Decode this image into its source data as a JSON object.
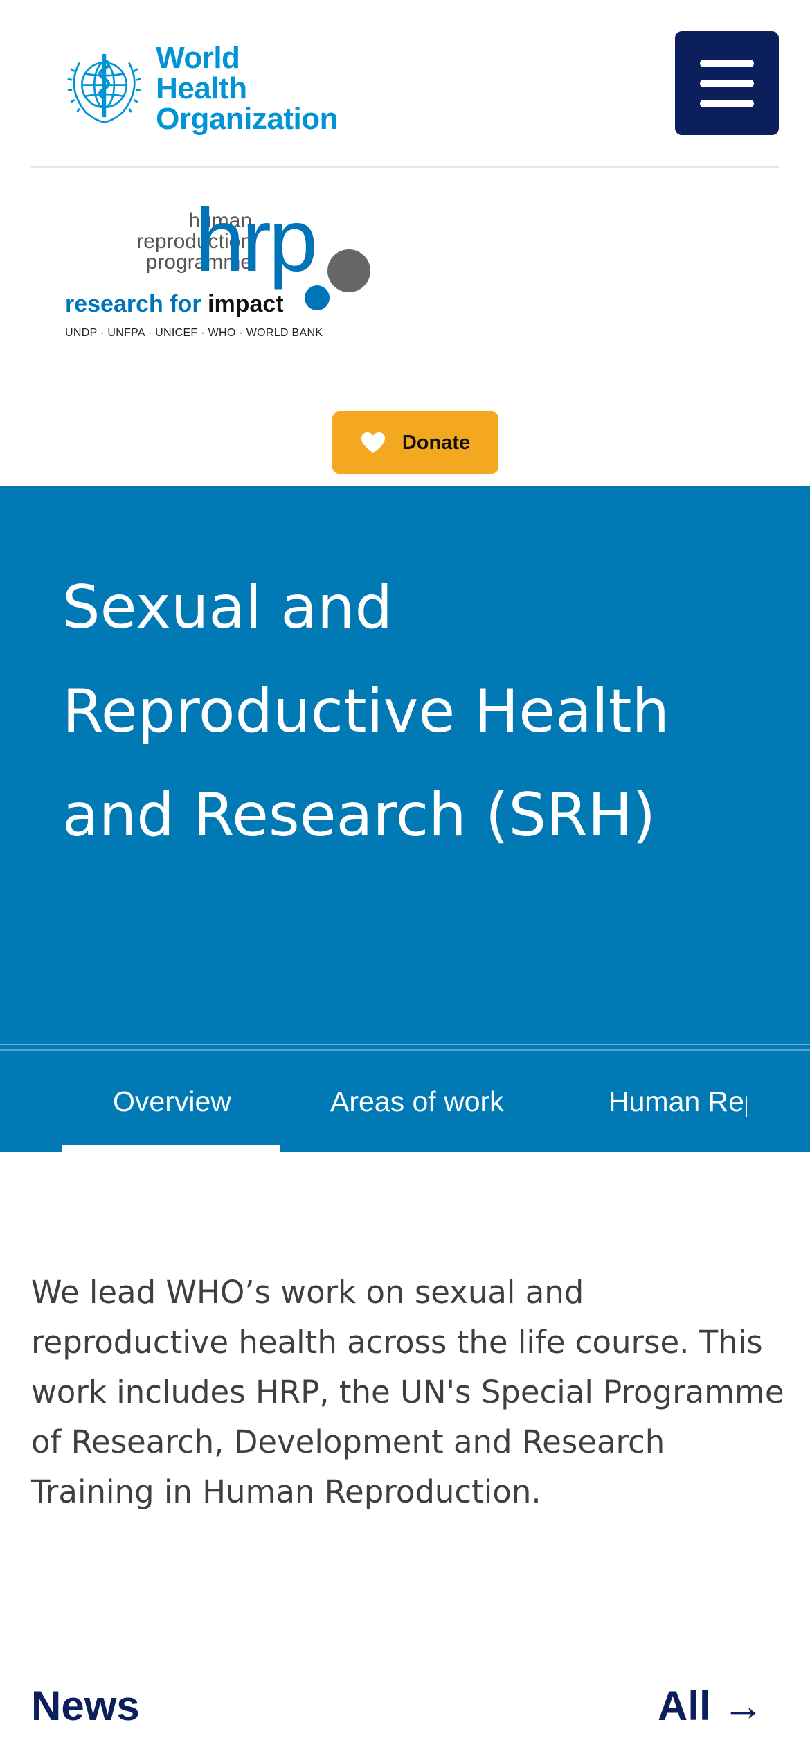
{
  "header": {
    "logo_line1": "World Health",
    "logo_line2": "Organization",
    "menu_icon": "hamburger-menu-icon"
  },
  "hrp_logo": {
    "left_words": [
      "human",
      "reproduction",
      "programme"
    ],
    "big_text": "hrp",
    "tagline_part1": "research for ",
    "tagline_part2": "impact",
    "partners": "UNDP · UNFPA · UNICEF · WHO · WORLD BANK"
  },
  "donate": {
    "label": "Donate",
    "icon": "heart-icon",
    "color": "#f3a81f"
  },
  "hero": {
    "title": "Sexual and Reproductive Health and Research (SRH)",
    "background": "#0079b5"
  },
  "tabs": [
    {
      "label": "Overview",
      "active": true
    },
    {
      "label": "Areas of work",
      "active": false
    },
    {
      "label": "Human Reproduction Programme",
      "active": false
    }
  ],
  "intro": {
    "text": "We lead WHO’s work on sexual and reproductive health across the life course. This work includes HRP, the UN's Special Programme of Research, Development and Research Training in Human Reproduction."
  },
  "news": {
    "heading": "News",
    "all_link": "All →"
  },
  "colors": {
    "navy": "#0a1f5c",
    "who_blue": "#0093d5"
  }
}
